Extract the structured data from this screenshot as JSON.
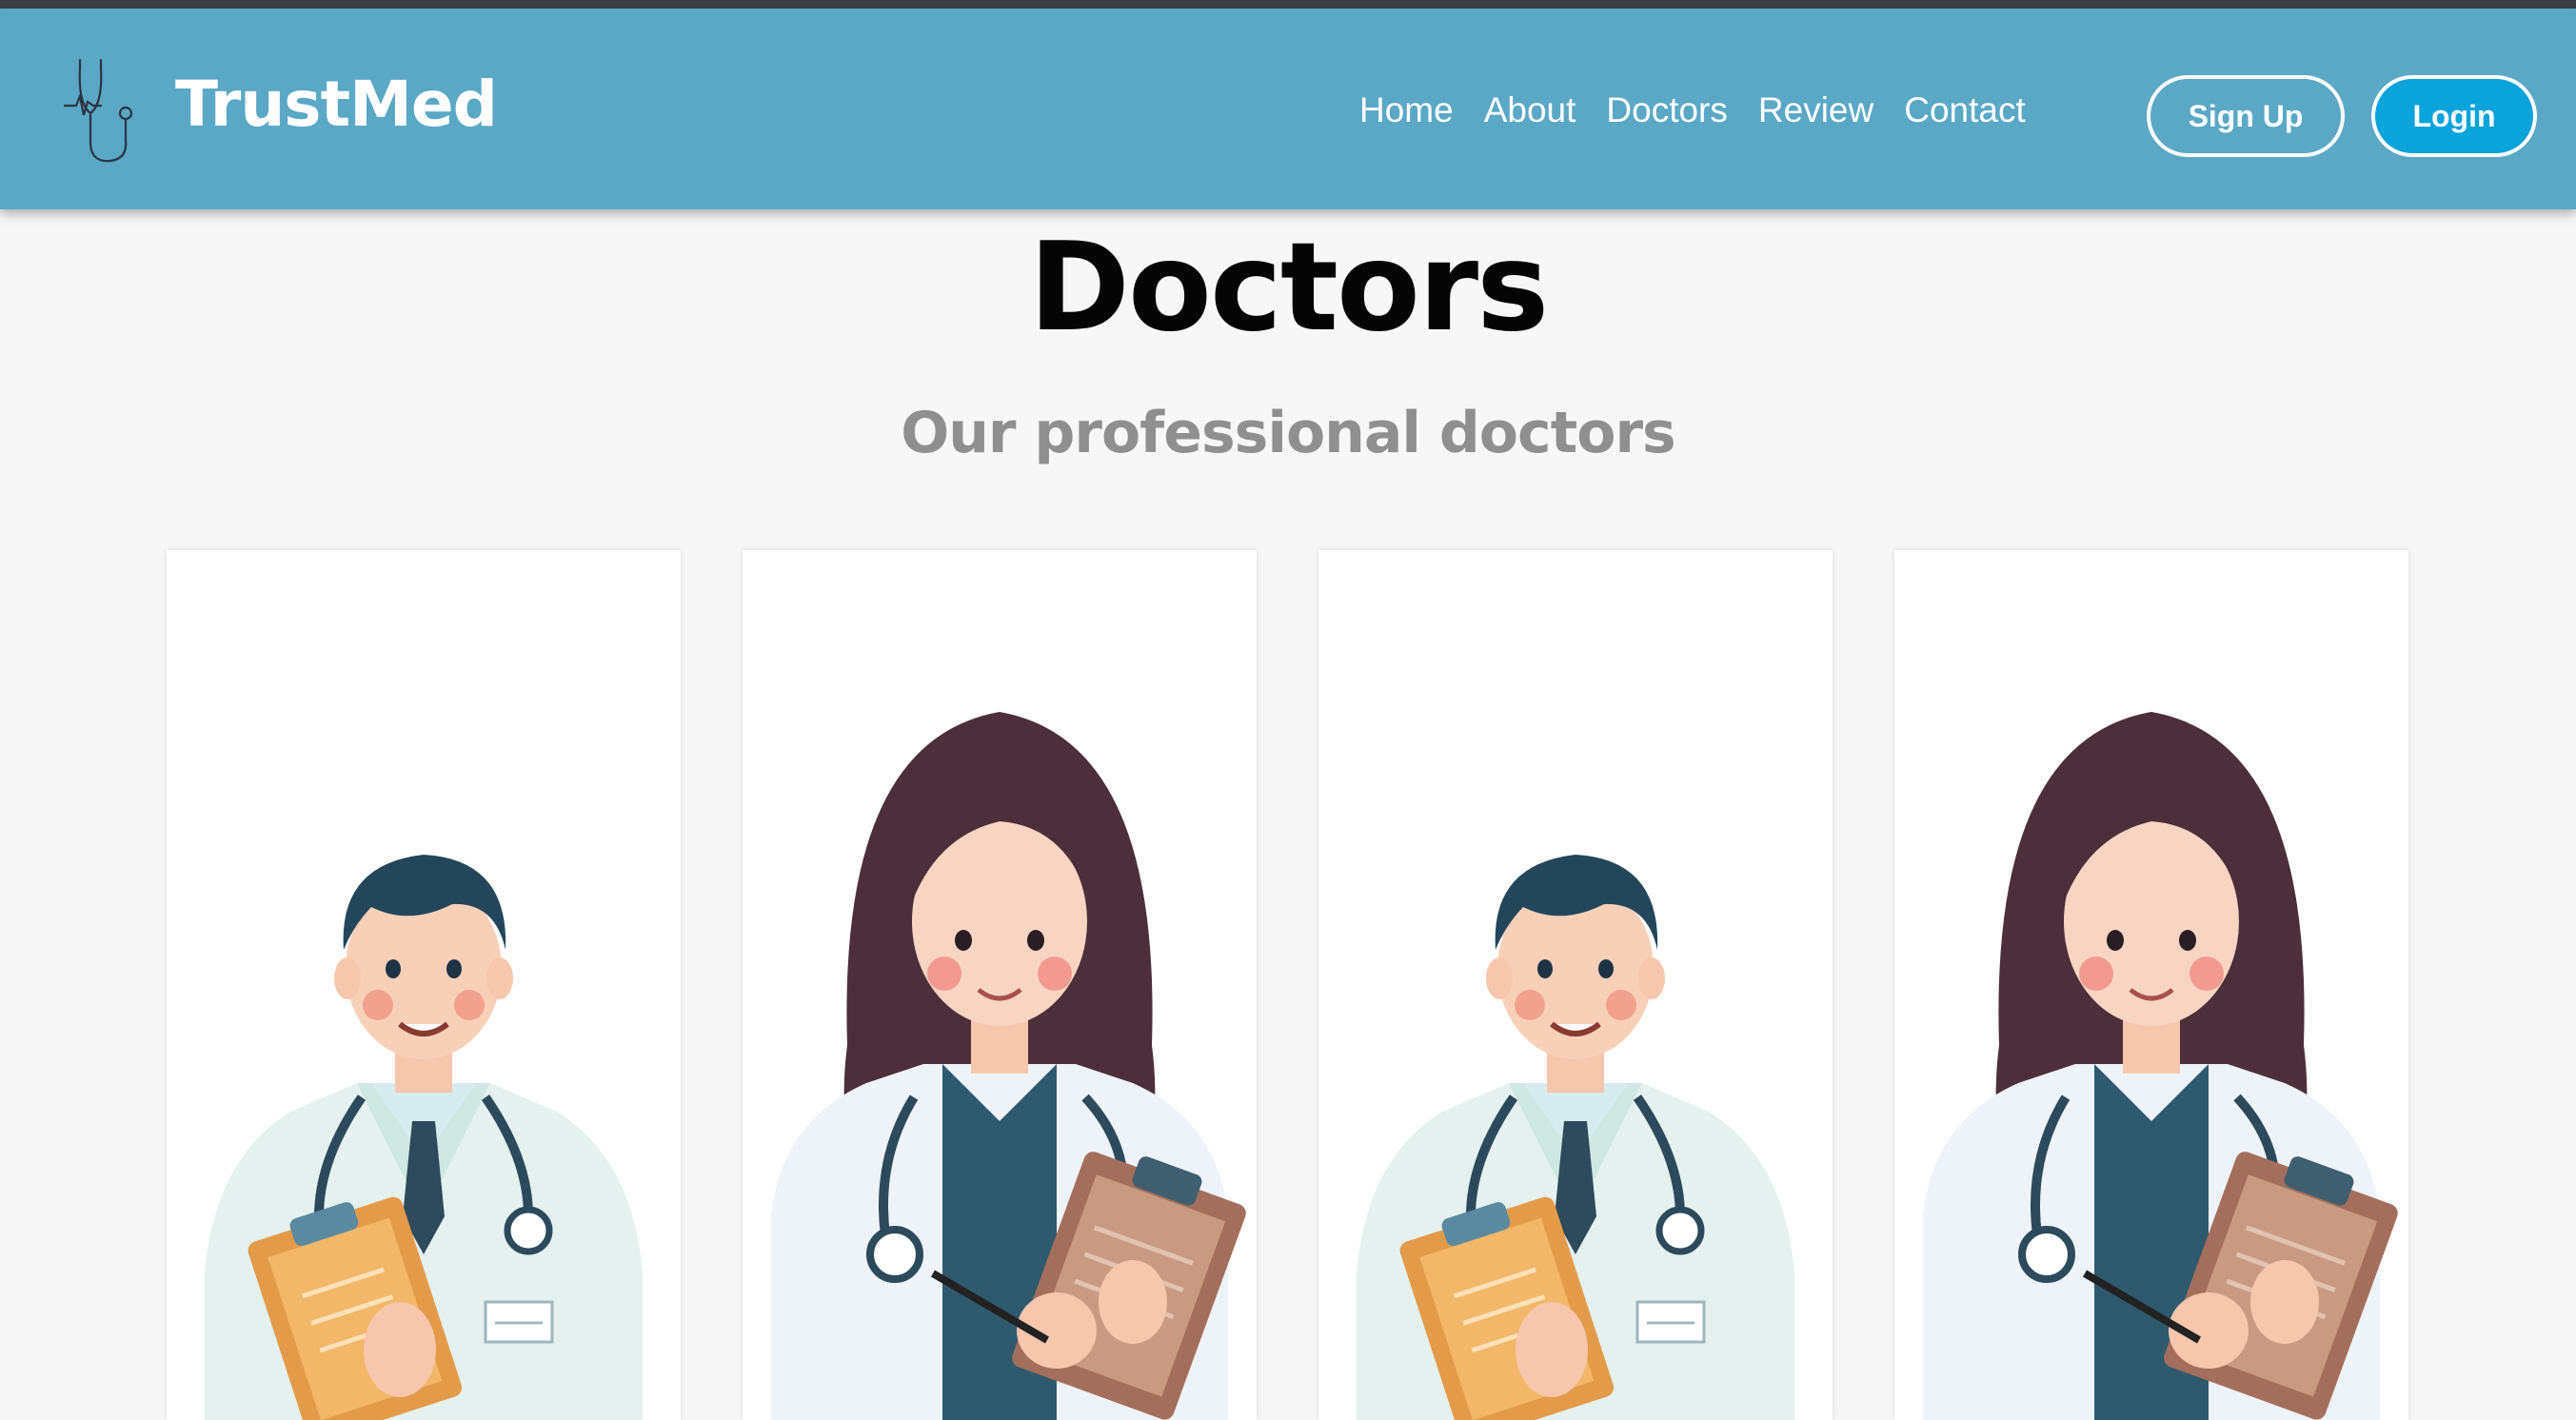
{
  "brand": {
    "name": "TrustMed"
  },
  "nav": {
    "links": [
      "Home",
      "About",
      "Doctors",
      "Review",
      "Contact"
    ],
    "signup_label": "Sign Up",
    "login_label": "Login"
  },
  "main": {
    "title": "Doctors",
    "subtitle": "Our professional doctors",
    "cards": [
      {
        "illustration": "male-doctor-illustration"
      },
      {
        "illustration": "female-doctor-illustration"
      },
      {
        "illustration": "male-doctor-illustration"
      },
      {
        "illustration": "female-doctor-illustration"
      }
    ]
  },
  "colors": {
    "navbar": "#5aa8c6",
    "login_button": "#0aa3dc",
    "title": "#050505",
    "subtitle": "#8f8f8f"
  }
}
